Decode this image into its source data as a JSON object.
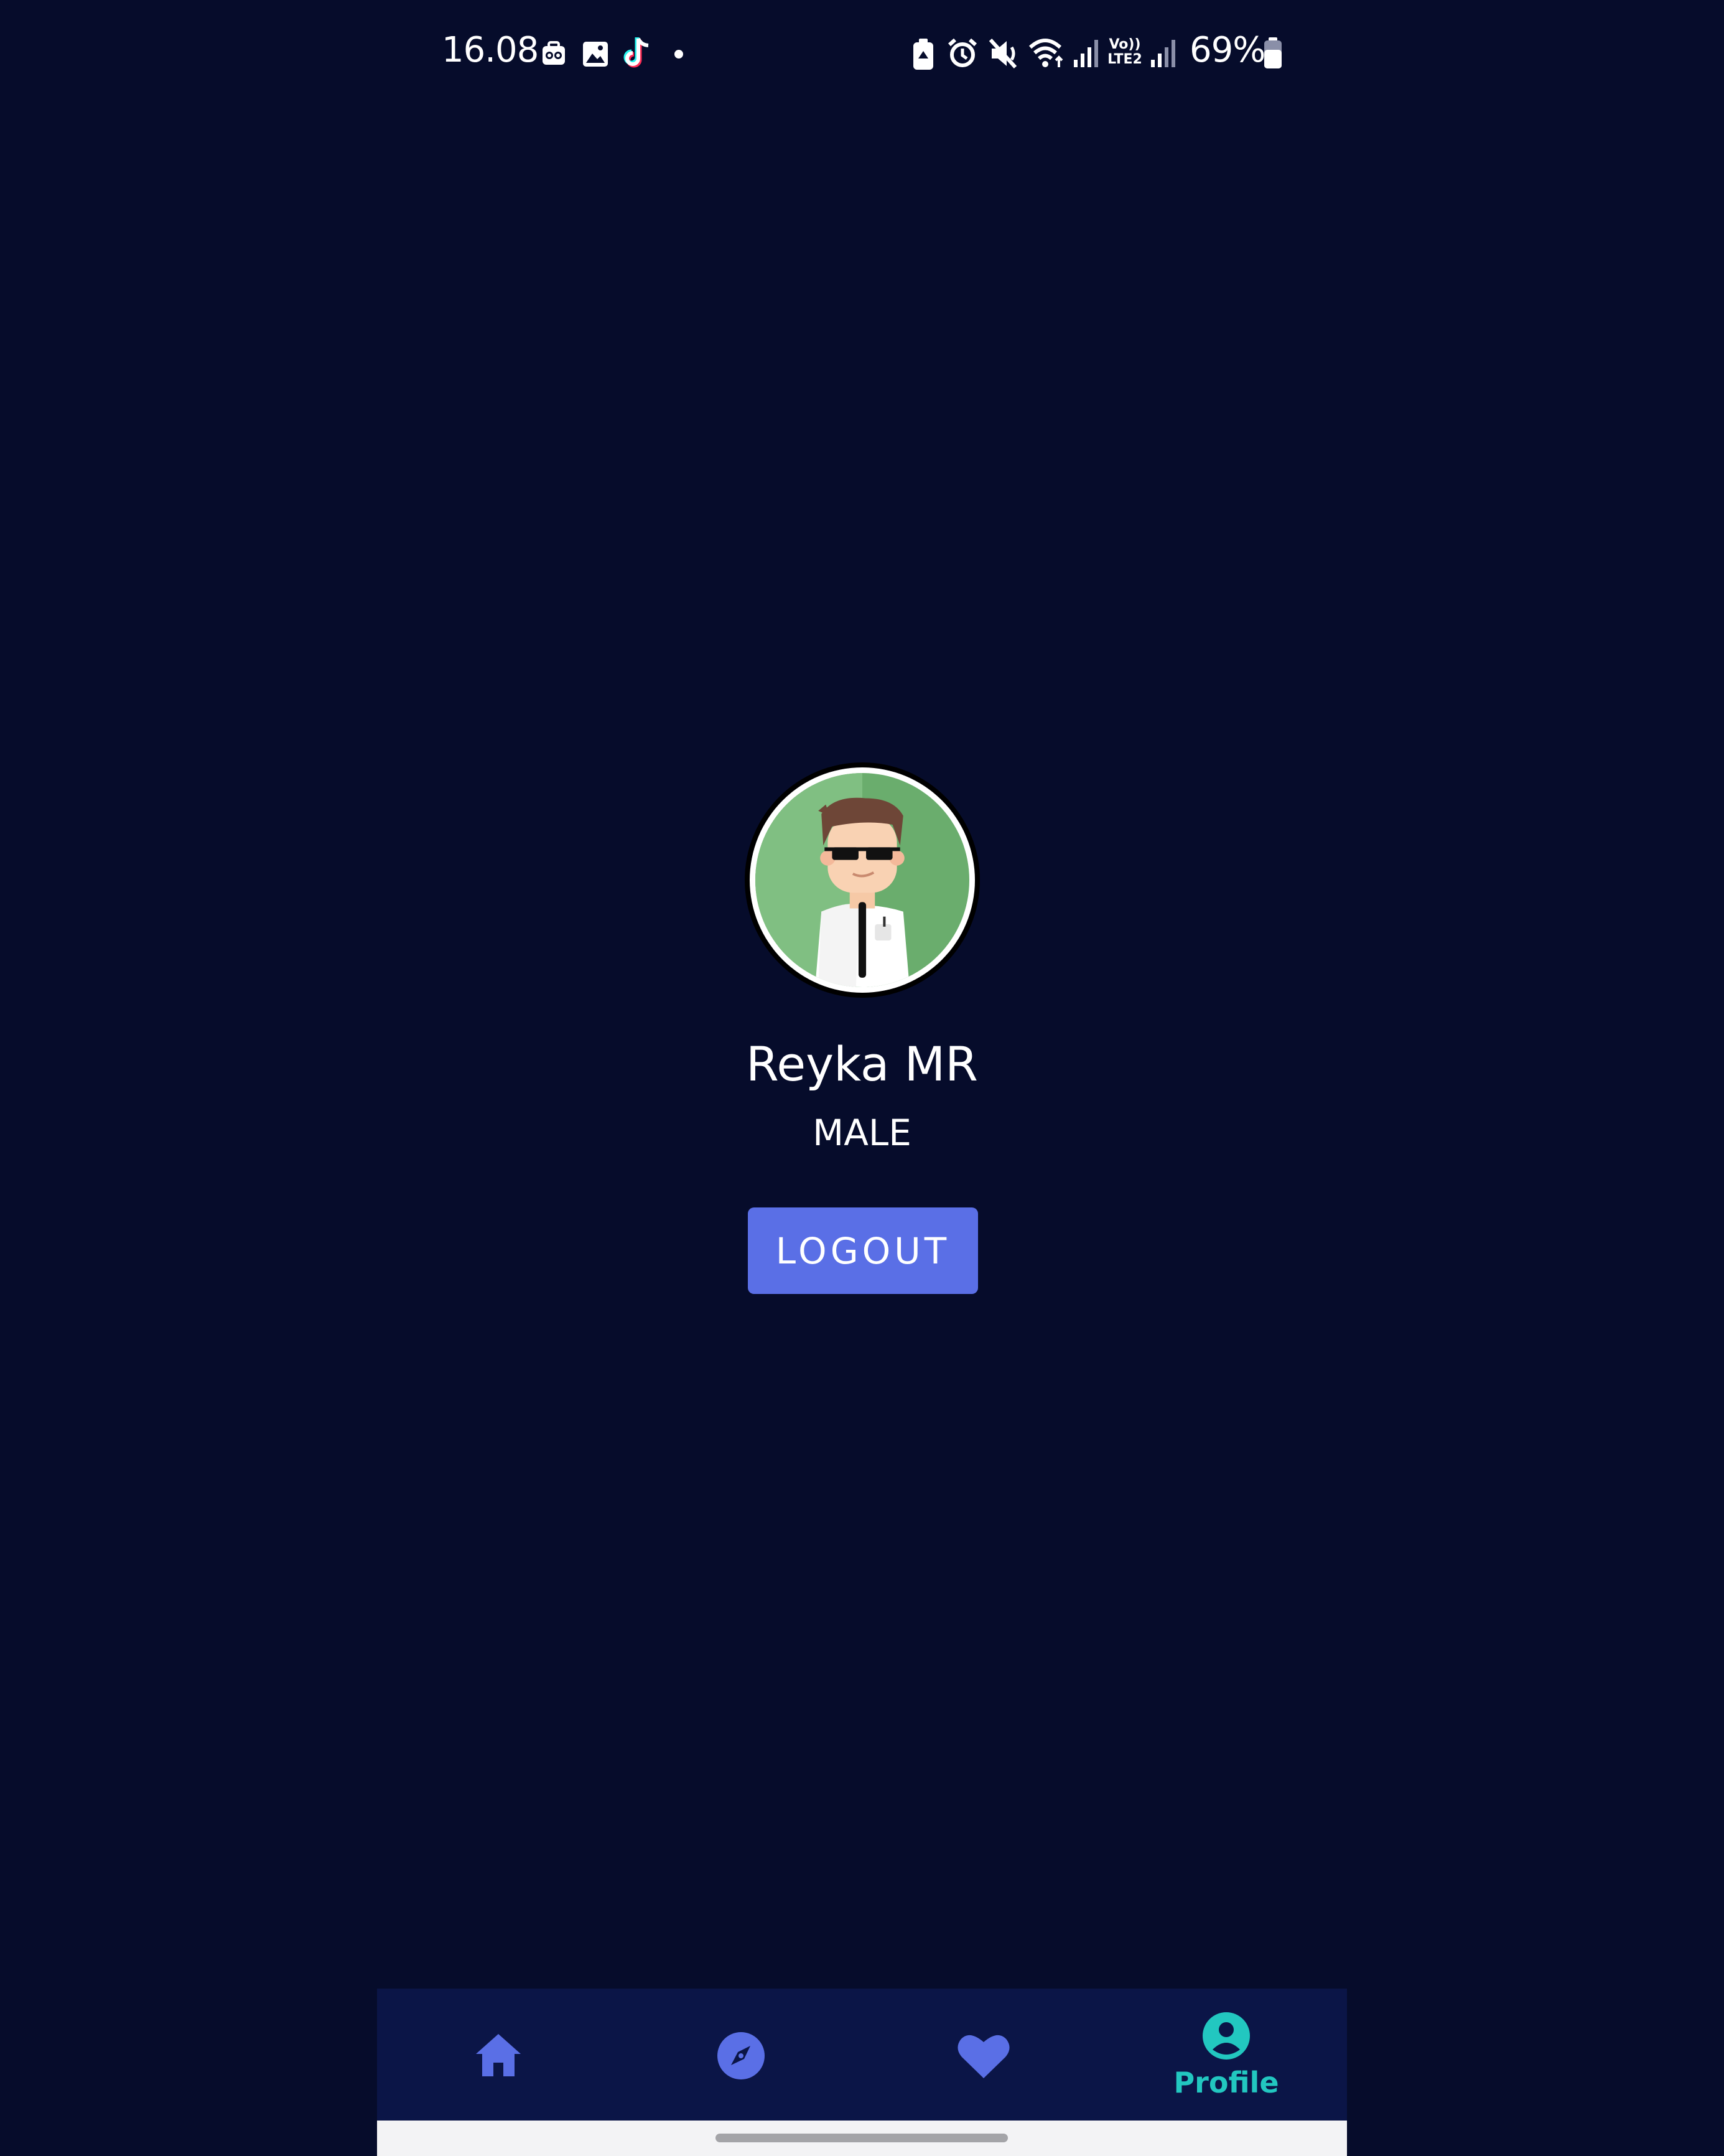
{
  "status_bar": {
    "time": "16.08",
    "battery": "69%",
    "icons_left": [
      "notification-app-icon",
      "gallery-icon",
      "tiktok-icon",
      "dot-icon"
    ],
    "icons_right": [
      "battery-saver-icon",
      "alarm-icon",
      "mute-icon",
      "wifi-icon",
      "signal-icon",
      "volte-icon",
      "signal-icon",
      "battery-icon"
    ],
    "volte_line1": "Vo))",
    "volte_line2": "LTE2"
  },
  "profile": {
    "name": "Reyka MR",
    "gender": "MALE"
  },
  "logout_label": "LOGOUT",
  "colors": {
    "background": "#060c2b",
    "nav_background": "#0b1547",
    "accent": "#5a6fe6",
    "active": "#22c7c0"
  },
  "bottom_nav": {
    "items": [
      {
        "icon": "home-icon",
        "label": "",
        "active": false
      },
      {
        "icon": "compass-icon",
        "label": "",
        "active": false
      },
      {
        "icon": "heart-icon",
        "label": "",
        "active": false
      },
      {
        "icon": "profile-icon",
        "label": "Profile",
        "active": true
      }
    ]
  }
}
